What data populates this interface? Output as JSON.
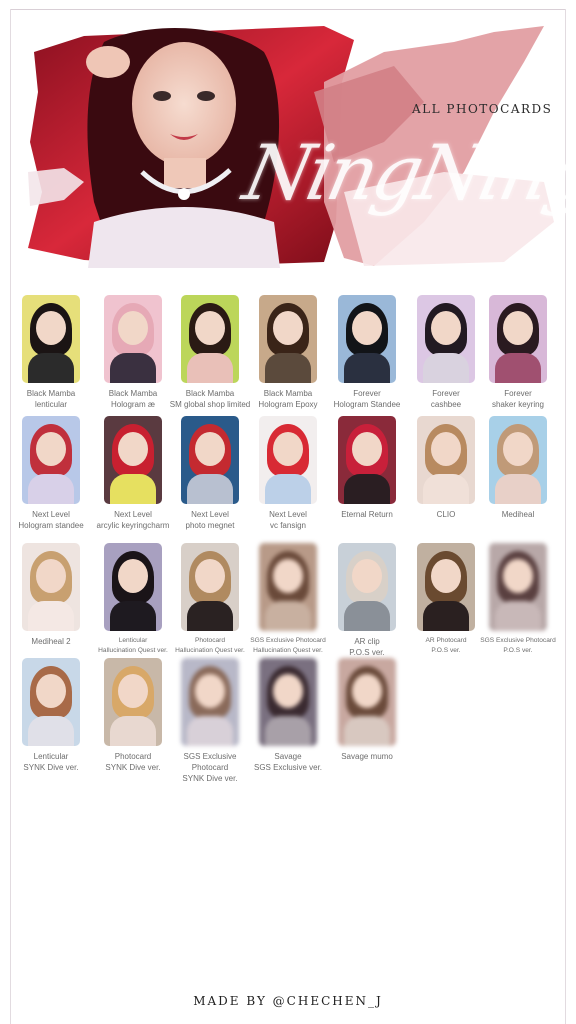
{
  "header": {
    "title": "ALL PHOTOCARDS",
    "name_script": "NingNing"
  },
  "cards": [
    {
      "line1": "Black Mamba",
      "line2": "lenticular",
      "bg": "#e6df7a",
      "hair": "#1b1414",
      "body": "#2b2b2b",
      "blur": false
    },
    {
      "line1": "Black Mamba",
      "line2": "Hologram æ",
      "bg": "#f0c3cf",
      "hair": "#e6a9b6",
      "body": "#3a3040",
      "blur": false
    },
    {
      "line1": "Black Mamba",
      "line2": "SM global shop limited",
      "bg": "#bcd65a",
      "hair": "#2a1a14",
      "body": "#e9c0b8",
      "blur": false
    },
    {
      "line1": "Black Mamba",
      "line2": "Hologram Epoxy",
      "bg": "#c7a98a",
      "hair": "#3a2418",
      "body": "#5b4a3c",
      "blur": false
    },
    {
      "line1": "Forever",
      "line2": "Hologram Standee",
      "bg": "#9ab8d8",
      "hair": "#121418",
      "body": "#2a3040",
      "blur": false
    },
    {
      "line1": "Forever",
      "line2": "cashbee",
      "bg": "#dcc7e4",
      "hair": "#221a22",
      "body": "#d9d2df",
      "blur": false
    },
    {
      "line1": "Forever",
      "line2": "shaker keyring",
      "bg": "#d8b8d8",
      "hair": "#2a1a20",
      "body": "#a05070",
      "blur": false
    },
    {
      "line1": "Next Level",
      "line2": "Hologram standee",
      "bg": "#b8c8e8",
      "hair": "#c0303c",
      "body": "#d8d0e8",
      "blur": false
    },
    {
      "line1": "Next Level",
      "line2": "arcylic keyringcharm",
      "bg": "#5a3a40",
      "hair": "#c82030",
      "body": "#e6e060",
      "blur": false
    },
    {
      "line1": "Next Level",
      "line2": "photo megnet",
      "bg": "#2a5a8a",
      "hair": "#c42a30",
      "body": "#b8c0d0",
      "blur": false
    },
    {
      "line1": "Next Level",
      "line2": "vc fansign",
      "bg": "#f2eeee",
      "hair": "#d82a34",
      "body": "#bcd0e8",
      "blur": false
    },
    {
      "line1": "Eternal Return",
      "line2": "",
      "bg": "#8a2a3a",
      "hair": "#c8203a",
      "body": "#2a1e22",
      "blur": false
    },
    {
      "line1": "CLIO",
      "line2": "",
      "bg": "#e8d8d0",
      "hair": "#b88a60",
      "body": "#f0e0d8",
      "blur": false
    },
    {
      "line1": "Mediheal",
      "line2": "",
      "bg": "#a8d0e8",
      "hair": "#c09a78",
      "body": "#e8d0c8",
      "blur": false
    },
    {
      "line1": "Mediheal 2",
      "line2": "",
      "bg": "#eee4e0",
      "hair": "#c8a070",
      "body": "#f4e8e4",
      "blur": false
    },
    {
      "line1": "Lenticular",
      "line2": "Hallucination Quest ver.",
      "bg": "#a8a0c0",
      "hair": "#1a1418",
      "body": "#1e1a20",
      "blur": false,
      "small": true
    },
    {
      "line1": "Photocard",
      "line2": "Hallucination Quest ver.",
      "bg": "#d8cfc8",
      "hair": "#b08a60",
      "body": "#2a2222",
      "blur": false,
      "small": true
    },
    {
      "line1": "SGS Exclusive Photocard",
      "line2": "Hallucination Quest ver.",
      "bg": "#b89a88",
      "hair": "#6a4a3a",
      "body": "#c8b0a0",
      "blur": true,
      "small": true
    },
    {
      "line1": "AR clip",
      "line2": "P.O.S ver.",
      "bg": "#c8d0d8",
      "hair": "#d8d0c8",
      "body": "#8a9098",
      "blur": false
    },
    {
      "line1": "AR Photocard",
      "line2": "P.O.S ver.",
      "bg": "#c0b0a0",
      "hair": "#6a4a30",
      "body": "#2a2020",
      "blur": false,
      "small": true
    },
    {
      "line1": "SGS Exclusive Photocard",
      "line2": "P.O.S ver.",
      "bg": "#b8a8a8",
      "hair": "#5a4040",
      "body": "#c8b8b8",
      "blur": true,
      "small": true
    },
    {
      "line1": "Lenticular",
      "line2": "SYNK Dive ver.",
      "bg": "#c8d8e8",
      "hair": "#a86a48",
      "body": "#e0e0e8",
      "blur": false
    },
    {
      "line1": "Photocard",
      "line2": "SYNK Dive ver.",
      "bg": "#c8b8a8",
      "hair": "#d8a868",
      "body": "#e8d8d0",
      "blur": false
    },
    {
      "line1": "SGS Exclusive Photocard",
      "line2": "SYNK Dive ver.",
      "bg": "#b8b8c8",
      "hair": "#8a6a5a",
      "body": "#d8d0d8",
      "blur": true
    },
    {
      "line1": "Savage",
      "line2": "SGS Exclusive ver.",
      "bg": "#7a7080",
      "hair": "#3a2a30",
      "body": "#a8a0a8",
      "blur": true
    },
    {
      "line1": "Savage mumo",
      "line2": "",
      "bg": "#c8a8a0",
      "hair": "#6a4a3a",
      "body": "#d8c8c0",
      "blur": true
    }
  ],
  "footer": {
    "credit": "MADE BY @CHECHEN_J"
  }
}
